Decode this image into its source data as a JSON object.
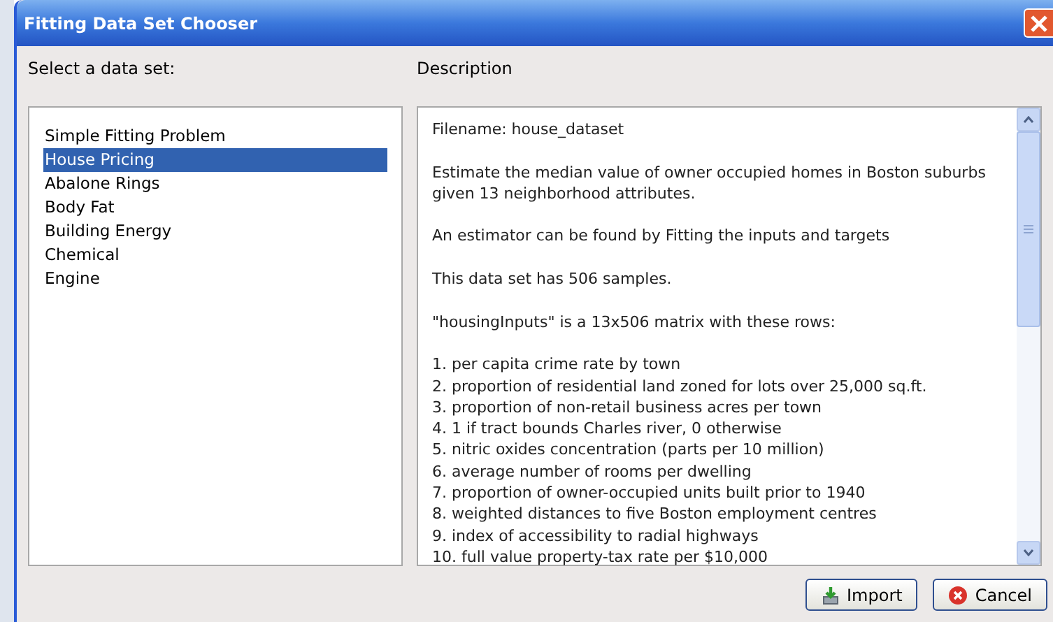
{
  "window": {
    "title": "Fitting Data Set Chooser"
  },
  "list_label": "Select a data set:",
  "datasets": [
    {
      "label": "Simple Fitting Problem",
      "selected": false
    },
    {
      "label": "House Pricing",
      "selected": true
    },
    {
      "label": "Abalone Rings",
      "selected": false
    },
    {
      "label": "Body Fat",
      "selected": false
    },
    {
      "label": "Building Energy",
      "selected": false
    },
    {
      "label": "Chemical",
      "selected": false
    },
    {
      "label": "Engine",
      "selected": false
    }
  ],
  "description_label": "Description",
  "description": {
    "paragraphs": [
      "Filename: house_dataset",
      "Estimate the median value of owner occupied homes in Boston suburbs given 13 neighborhood attributes.",
      "An estimator can be found by Fitting the inputs and targets",
      "This data set has 506 samples.",
      "\"housingInputs\" is a 13x506 matrix with these rows:"
    ],
    "rows": [
      "1. per capita crime rate by town",
      "2. proportion of residential land zoned for lots over 25,000 sq.ft.",
      "3. proportion of non-retail business acres per town",
      "4. 1 if tract bounds Charles river, 0 otherwise",
      "5. nitric oxides concentration (parts per 10 million)",
      "6. average number of rooms per dwelling",
      "7. proportion of owner-occupied units built prior to 1940",
      "8. weighted distances to five Boston employment centres",
      "9. index of accessibility to radial highways",
      "10. full value property-tax rate per $10,000"
    ]
  },
  "buttons": [
    {
      "label": "Import",
      "kind": "import"
    },
    {
      "label": "Cancel",
      "kind": "cancel"
    }
  ]
}
